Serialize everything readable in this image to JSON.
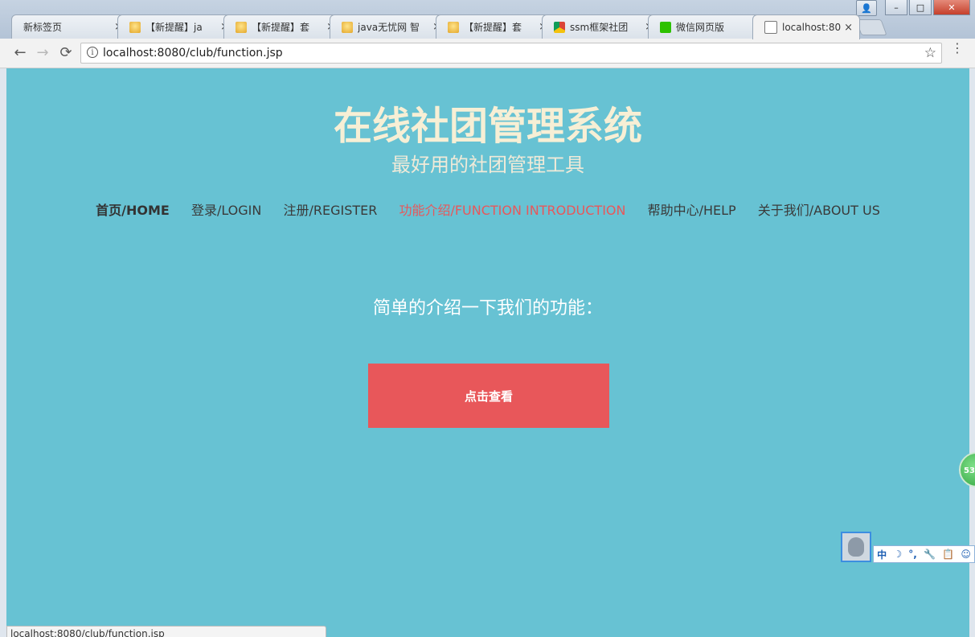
{
  "browser": {
    "tabs": [
      {
        "label": "新标签页",
        "icon": "none"
      },
      {
        "label": "【新提醒】ja",
        "icon": "bell-icon"
      },
      {
        "label": "【新提醒】套",
        "icon": "bell-icon"
      },
      {
        "label": "java无忧网 智",
        "icon": "bell-icon"
      },
      {
        "label": "【新提醒】套",
        "icon": "bell-icon"
      },
      {
        "label": "ssm框架社团",
        "icon": "chrome-icon"
      },
      {
        "label": "微信网页版",
        "icon": "wechat-icon"
      },
      {
        "label": "localhost:80",
        "icon": "document-icon"
      }
    ],
    "close_glyph": "×",
    "window_buttons": {
      "user": "👤",
      "minimize": "–",
      "maximize": "□",
      "close": "✕"
    },
    "address": "localhost:8080/club/function.jsp",
    "back": "←",
    "forward": "→",
    "reload": "⟳",
    "star": "☆",
    "info": "i",
    "menu": "⋮",
    "status": "localhost:8080/club/function.jsp"
  },
  "site": {
    "title": "在线社团管理系统",
    "subtitle": "最好用的社团管理工具",
    "nav": {
      "home": "首页/HOME",
      "login": "登录/LOGIN",
      "register": "注册/REGISTER",
      "function": "功能介绍/FUNCTION INTRODUCTION",
      "help": "帮助中心/HELP",
      "about": "关于我们/ABOUT US"
    },
    "intro": "简单的介绍一下我们的功能：",
    "view_button": "点击查看"
  },
  "widgets": {
    "badge": "53",
    "ime_tools": [
      "中",
      "☽",
      "°,",
      "🔧",
      "📋",
      "☺"
    ]
  },
  "colors": {
    "page_bg": "#67c2d3",
    "accent": "#e8575a",
    "title": "#f7efd5"
  }
}
